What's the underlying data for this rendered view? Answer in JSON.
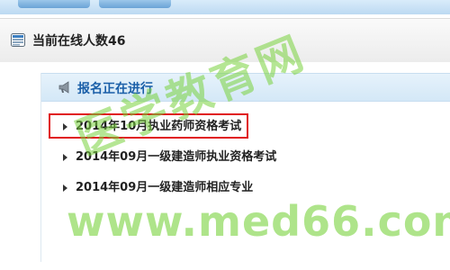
{
  "header": {
    "online_label": "当前在线人数46",
    "icon": "online-users-icon"
  },
  "registration": {
    "title": "报名正在进行",
    "icon": "megaphone-icon",
    "items": [
      {
        "label": "2014年10月执业药师资格考试",
        "highlighted": true
      },
      {
        "label": "2014年09月一级建造师执业资格考试",
        "highlighted": false
      },
      {
        "label": "2014年09月一级建造师相应专业",
        "highlighted": false
      }
    ]
  },
  "watermark": {
    "text_cn": "医学教育网",
    "url": "www.med66.com"
  },
  "colors": {
    "highlight_border": "#e0161b",
    "title_blue": "#1a5fa8",
    "watermark_green": "#78d23c"
  }
}
